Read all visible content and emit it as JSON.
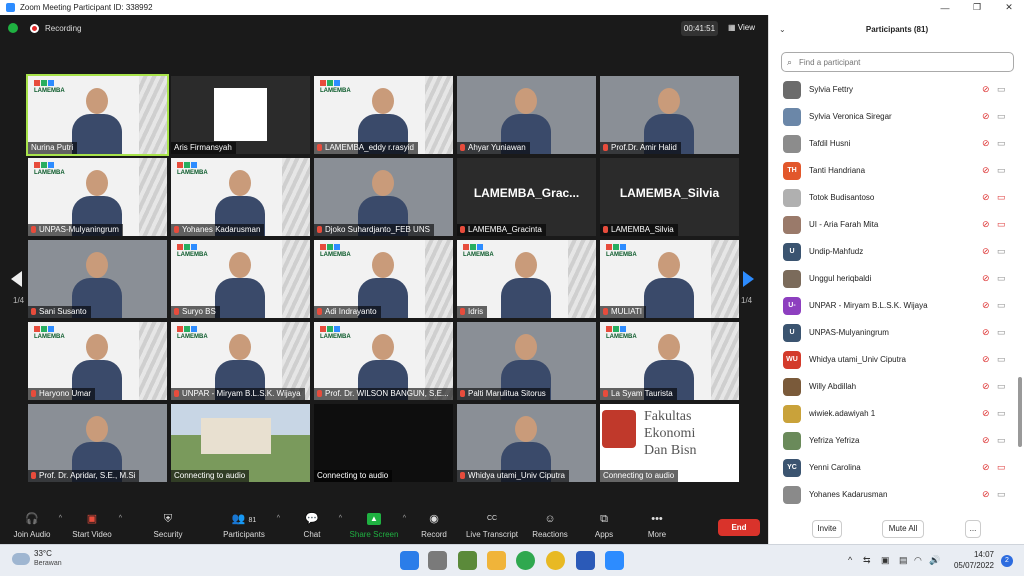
{
  "window": {
    "title": "Zoom Meeting Participant ID: 338992"
  },
  "topbar": {
    "recording_label": "Recording",
    "timer": "00:41:51",
    "view_label": "View"
  },
  "pager": {
    "left": "1/4",
    "right": "1/4"
  },
  "tiles": [
    {
      "name": "Nurina Putri",
      "kind": "lamemba",
      "muted": false,
      "active": true
    },
    {
      "name": "Aris Firmansyah",
      "kind": "whitebox",
      "muted": false
    },
    {
      "name": "LAMEMBA_eddy r.rasyid",
      "kind": "lamemba",
      "muted": true
    },
    {
      "name": "Ahyar Yuniawan",
      "kind": "plain",
      "muted": true
    },
    {
      "name": "Prof.Dr. Amir Halid",
      "kind": "plain",
      "muted": true
    },
    {
      "name": "UNPAS-Mulyaningrum",
      "kind": "lamemba",
      "muted": true
    },
    {
      "name": "Yohanes Kadarusman",
      "kind": "lamemba",
      "muted": true
    },
    {
      "name": "Djoko Suhardjanto_FEB UNS",
      "kind": "plain",
      "muted": true
    },
    {
      "name": "LAMEMBA_Gracinta",
      "kind": "text",
      "big": "LAMEMBA_Grac...",
      "muted": true
    },
    {
      "name": "LAMEMBA_Silvia",
      "kind": "text",
      "big": "LAMEMBA_Silvia",
      "muted": true
    },
    {
      "name": "Sani Susanto",
      "kind": "plain",
      "muted": true
    },
    {
      "name": "Suryo BS",
      "kind": "lamemba",
      "muted": true
    },
    {
      "name": "Adi Indrayanto",
      "kind": "lamemba",
      "muted": true
    },
    {
      "name": "Idris",
      "kind": "lamemba",
      "muted": true
    },
    {
      "name": "MULIATI",
      "kind": "lamemba",
      "muted": true
    },
    {
      "name": "Haryono Umar",
      "kind": "lamemba",
      "muted": true
    },
    {
      "name": "UNPAR - Miryam B.L.S.K. Wijaya",
      "kind": "lamemba",
      "muted": true
    },
    {
      "name": "Prof. Dr. WILSON BANGUN, S.E...",
      "kind": "lamemba",
      "muted": true
    },
    {
      "name": "Palti Marulitua Sitorus",
      "kind": "plain",
      "muted": true
    },
    {
      "name": "La Syam Taurista",
      "kind": "lamemba",
      "muted": true
    },
    {
      "name": "Prof. Dr. Apridar, S.E., M.Si",
      "kind": "plain",
      "muted": true
    },
    {
      "name": "Connecting to audio",
      "kind": "building",
      "muted": false
    },
    {
      "name": "Connecting to audio",
      "kind": "dark",
      "muted": false
    },
    {
      "name": "Whidya utami_Univ Ciputra",
      "kind": "plain",
      "muted": true
    },
    {
      "name": "Connecting to audio",
      "kind": "fakultas",
      "muted": false
    }
  ],
  "fakultas_text": [
    "Fakultas",
    "Ekonomi",
    "Dan Bisn"
  ],
  "toolbar": {
    "join_audio": "Join Audio",
    "start_video": "Start Video",
    "security": "Security",
    "participants": "Participants",
    "participants_count": "81",
    "chat": "Chat",
    "share_screen": "Share Screen",
    "record": "Record",
    "live_transcript": "Live Transcript",
    "reactions": "Reactions",
    "apps": "Apps",
    "more": "More",
    "end": "End"
  },
  "panel": {
    "title": "Participants (81)",
    "search_placeholder": "Find a participant",
    "invite": "Invite",
    "mute_all": "Mute All",
    "more": "...",
    "participants": [
      {
        "name": "Sylvia Fettry",
        "initials": "",
        "color": "#6b6b6b",
        "video_off": false
      },
      {
        "name": "Sylvia Veronica Siregar",
        "initials": "",
        "color": "#6b87a8",
        "video_off": false
      },
      {
        "name": "Tafdil Husni",
        "initials": "",
        "color": "#8c8c8c",
        "video_off": false
      },
      {
        "name": "Tanti Handriana",
        "initials": "TH",
        "color": "#e2572b",
        "video_off": false
      },
      {
        "name": "Totok Budisantoso",
        "initials": "",
        "color": "#b0b0b0",
        "video_off": true
      },
      {
        "name": "UI - Aria Farah Mita",
        "initials": "",
        "color": "#9a7a6a",
        "video_off": true
      },
      {
        "name": "Undip-Mahfudz",
        "initials": "U",
        "color": "#3b5470",
        "video_off": false
      },
      {
        "name": "Unggul heriqbaldi",
        "initials": "",
        "color": "#7b6b5b",
        "video_off": false
      },
      {
        "name": "UNPAR - Miryam B.L.S.K. Wijaya",
        "initials": "U-",
        "color": "#8d3fbf",
        "video_off": false
      },
      {
        "name": "UNPAS-Mulyaningrum",
        "initials": "U",
        "color": "#3b5470",
        "video_off": false
      },
      {
        "name": "Whidya utami_Univ Ciputra",
        "initials": "WU",
        "color": "#d33b2b",
        "video_off": false
      },
      {
        "name": "Willy Abdillah",
        "initials": "",
        "color": "#7a5a3a",
        "video_off": false
      },
      {
        "name": "wiwiek.adawiyah 1",
        "initials": "",
        "color": "#c9a23a",
        "video_off": false
      },
      {
        "name": "Yefriza Yefriza",
        "initials": "",
        "color": "#6a8a5a",
        "video_off": false
      },
      {
        "name": "Yenni Carolina",
        "initials": "YC",
        "color": "#3b5470",
        "video_off": true
      },
      {
        "name": "Yohanes Kadarusman",
        "initials": "",
        "color": "#8a8a8a",
        "video_off": false
      }
    ]
  },
  "taskbar": {
    "temperature": "33°C",
    "weather": "Berawan",
    "time": "14:07",
    "date": "05/07/2022",
    "notifications": "2"
  }
}
